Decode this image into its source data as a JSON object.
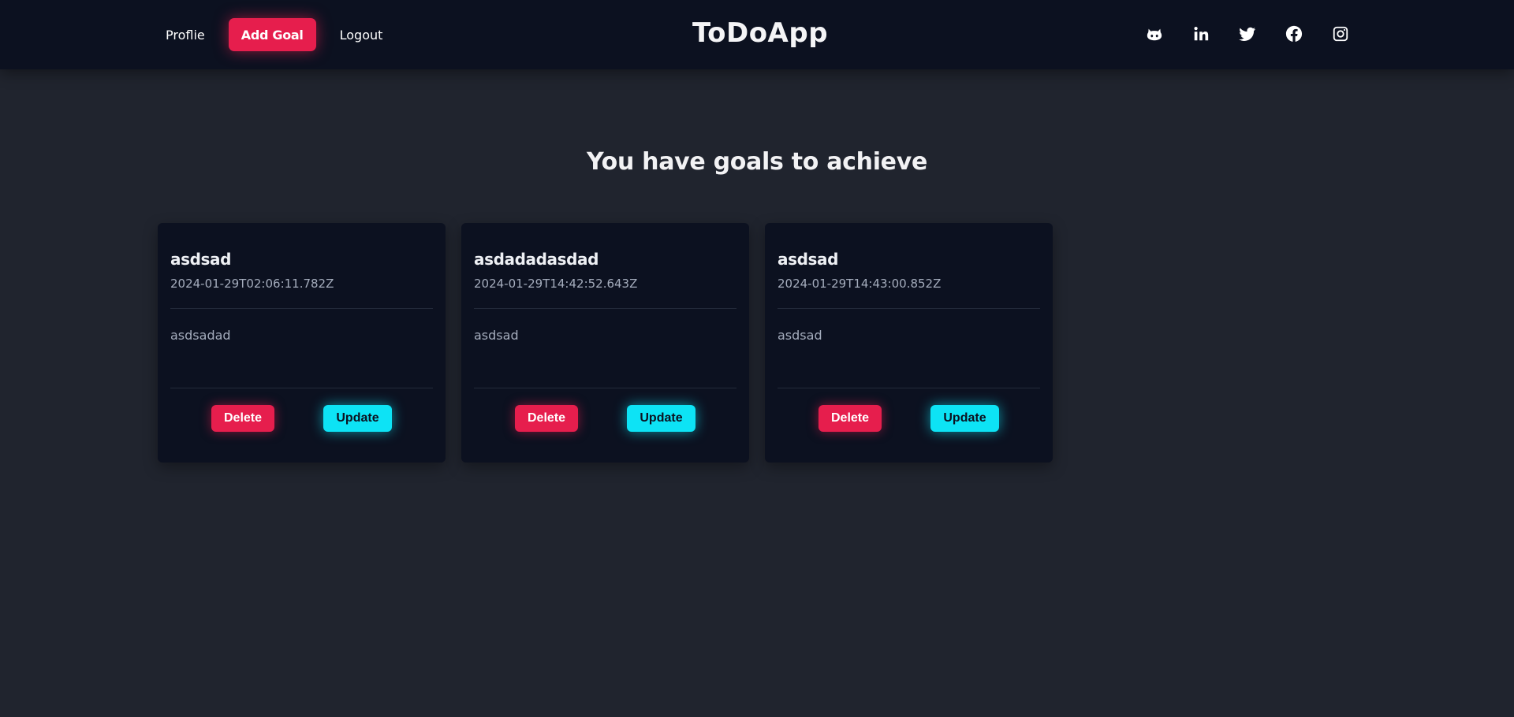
{
  "nav": {
    "profile_label": "Proflie",
    "add_goal_label": "Add Goal",
    "logout_label": "Logout",
    "brand": "ToDoApp",
    "social_icons": [
      "github-icon",
      "linkedin-icon",
      "twitter-icon",
      "facebook-icon",
      "instagram-icon"
    ]
  },
  "main": {
    "heading": "You have goals to achieve",
    "goals": [
      {
        "title": "asdsad",
        "date": "2024-01-29T02:06:11.782Z",
        "description": "asdsadad",
        "delete_label": "Delete",
        "update_label": "Update"
      },
      {
        "title": "asdadadasdad",
        "date": "2024-01-29T14:42:52.643Z",
        "description": "asdsad",
        "delete_label": "Delete",
        "update_label": "Update"
      },
      {
        "title": "asdsad",
        "date": "2024-01-29T14:43:00.852Z",
        "description": "asdsad",
        "delete_label": "Delete",
        "update_label": "Update"
      }
    ]
  },
  "colors": {
    "accent_red": "#e61e4d",
    "accent_cyan": "#0de3f5",
    "navbar_bg": "#0c1120",
    "page_bg": "#20242e"
  }
}
